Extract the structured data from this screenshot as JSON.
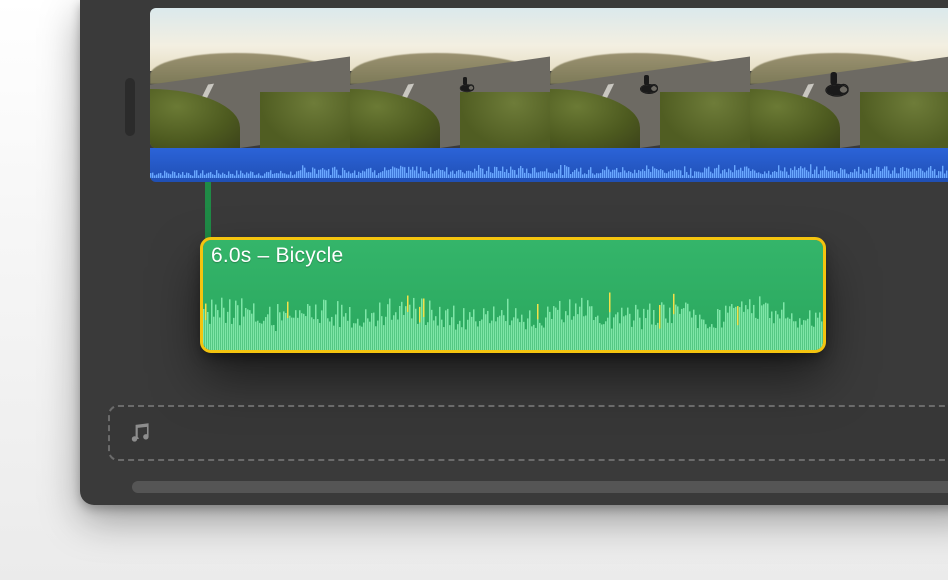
{
  "timeline": {
    "video_clip": {
      "thumb_count": 4,
      "audio_waveform_color": "#6aa8ff"
    },
    "connected_audio_clip": {
      "label": "6.0s – Bicycle",
      "duration_seconds": 6.0,
      "name": "Bicycle",
      "selected": true,
      "selection_color": "#f4c40f",
      "fill_color": "#2fae63",
      "waveform_color": "#7fe6a8",
      "peak_color": "#f4e04a"
    },
    "music_track": {
      "icon": "music-note-icon",
      "empty": true
    }
  }
}
